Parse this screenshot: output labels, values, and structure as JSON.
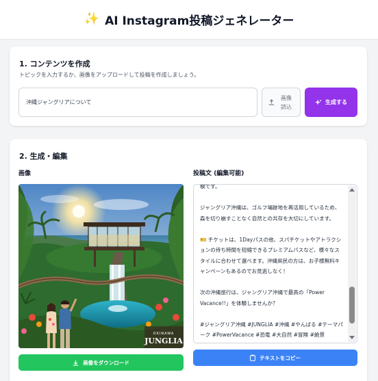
{
  "header": {
    "title": "AI Instagram投稿ジェネレーター",
    "icon": "sparkles-icon",
    "accent": "#7c3aed"
  },
  "section1": {
    "title": "1. コンテンツを作成",
    "description": "トピックを入力するか、画像をアップロードして投稿を作成しましょう。",
    "topic_value": "沖縄ジャングリアについて",
    "upload_label": "画像読込",
    "generate_label": "生成する",
    "generate_color": "#9333ea"
  },
  "section2": {
    "title": "2. 生成・編集",
    "image_label": "画像",
    "post_label": "投稿文 (編集可能)",
    "image_caption_small": "OKINAWA",
    "image_caption_big": "JUNGLIA",
    "download_label": "画像をダウンロード",
    "copy_label": "テキストをコピー",
    "post_text": "験です。\n\nジャングリア沖縄は、ゴルフ場跡地を再活用しているため、森を切り崩すことなく自然との共存を大切にしています。\n\n🎫 チケットは、1Dayパスの他、スパチケットやアトラクションの待ち時間を短縮できるプレミアムパスなど、様々なスタイルに合わせて選べます。沖縄県民の方は、お子様無料キャンペーンもあるのでお見逃しなく！\n\n次の沖縄旅行は、ジャングリア沖縄で最高の「Power Vacance!!」を体験しませんか？\n\n#ジャングリア沖縄 #JUNGLIA #沖縄 #やんばる #テーマパーク #PowerVacance #恐竜 #大自然 #冒険 #絶景",
    "download_color": "#22c55e",
    "copy_color": "#3b82f6"
  }
}
